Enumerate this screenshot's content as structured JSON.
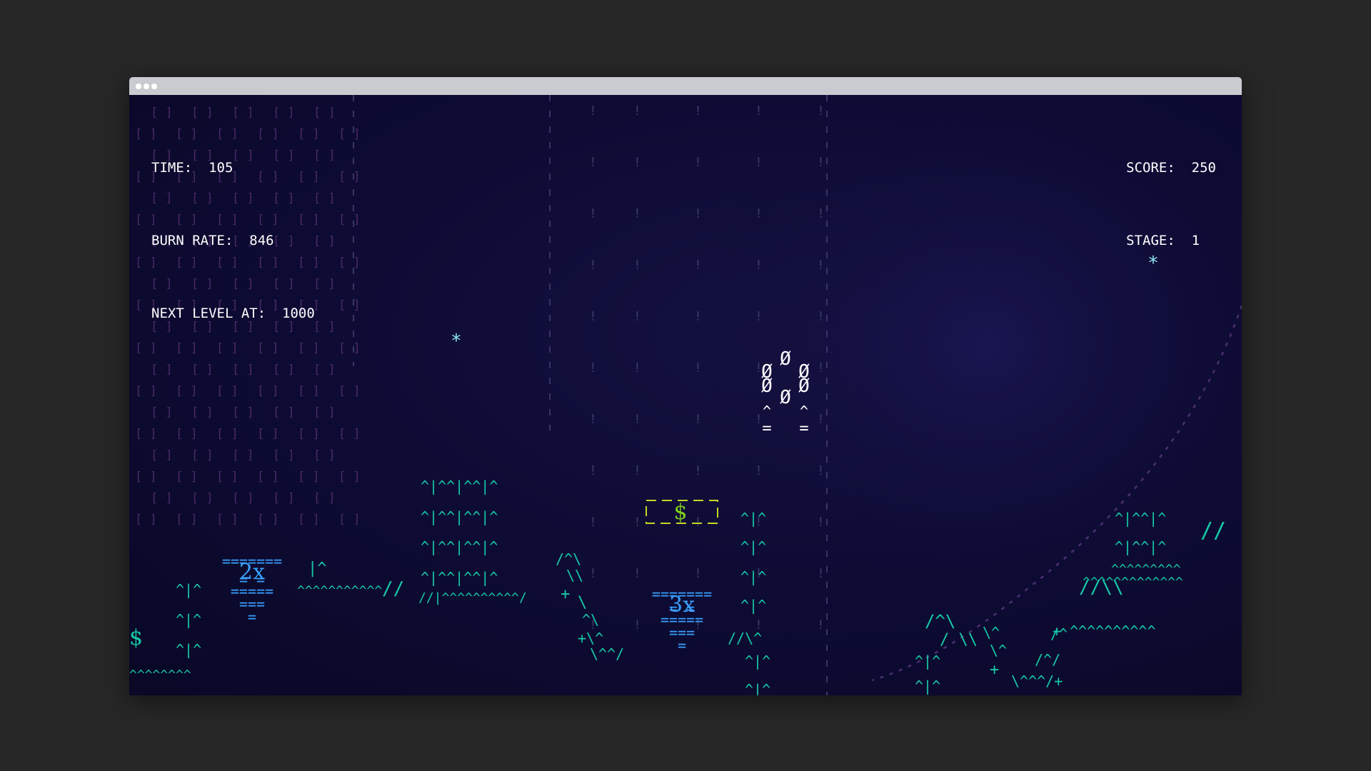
{
  "hud": {
    "time_label": "TIME:",
    "time_value": "105",
    "burn_label": "BURN RATE:",
    "burn_value": "846",
    "next_label": "NEXT LEVEL AT:",
    "next_value": "1000",
    "score_label": "SCORE:",
    "score_value": "250",
    "stage_label": "STAGE:",
    "stage_value": "1"
  },
  "pickups": {
    "cash_symbol": "$",
    "multiplier_2": "2x",
    "multiplier_3": "3x",
    "edge_cash_symbol": "$"
  },
  "icons": {
    "window_controls": [
      "window-dot-icon",
      "window-dot-icon",
      "window-dot-icon"
    ],
    "player": "player-ship-icon",
    "star": "star-asterisk-icon"
  },
  "colors": {
    "terrain": "#17c9a6",
    "multiplier": "#3aa0ff",
    "cash": "#7acc1e",
    "cash_frame": "#c8d622",
    "brick": "#4a2a66",
    "rain": "#3a3a66",
    "star": "#8ee6f0",
    "player": "#ffffff"
  }
}
